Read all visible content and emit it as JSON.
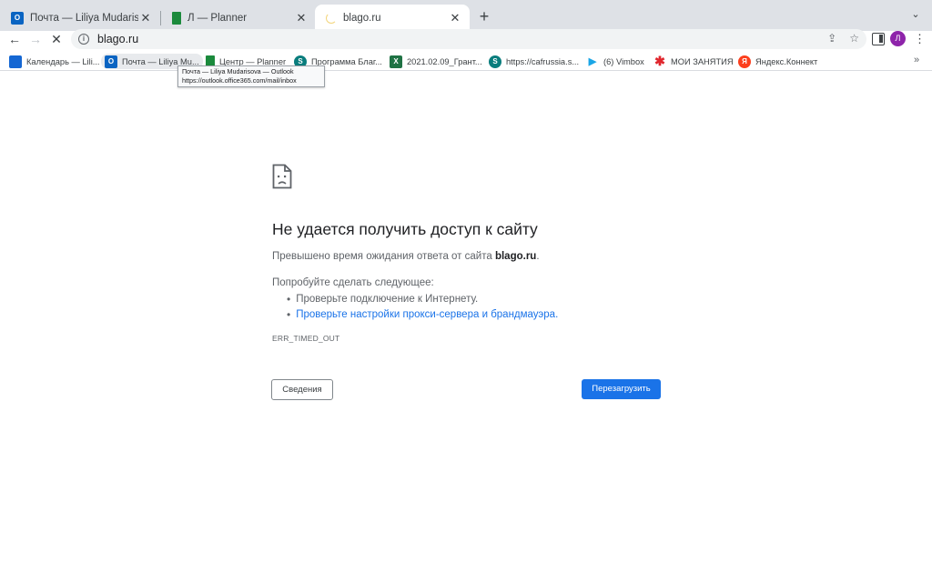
{
  "tabs": [
    {
      "title": "Почта — Liliya Mudarisova — ",
      "favicon": "outlook-icon"
    },
    {
      "title": "Л — Planner",
      "favicon": "planner-icon"
    },
    {
      "title": "blago.ru",
      "favicon": "loading-spinner-icon",
      "active": true
    }
  ],
  "toolbar": {
    "url": "blago.ru",
    "avatar_letter": "Л"
  },
  "bookmarks": [
    {
      "label": "Календарь — Lili...",
      "icon": "calendar-icon"
    },
    {
      "label": "Почта — Liliya Mu...",
      "icon": "outlook-icon"
    },
    {
      "label": "Центр — Planner",
      "icon": "planner-icon"
    },
    {
      "label": "Программа Благ...",
      "icon": "sway-icon"
    },
    {
      "label": "2021.02.09_Грант...",
      "icon": "excel-icon"
    },
    {
      "label": "https://cafrussia.s...",
      "icon": "sway-icon"
    },
    {
      "label": "(6) Vimbox",
      "icon": "vimbox-icon"
    },
    {
      "label": "МОИ ЗАНЯТИЯ",
      "icon": "star-icon"
    },
    {
      "label": "Яндекс.Коннект",
      "icon": "yandex-icon"
    }
  ],
  "tooltip": {
    "title": "Почта — Liliya Mudarisova — Outlook",
    "url": "https://outlook.office365.com/mail/inbox"
  },
  "error": {
    "title": "Не удается получить доступ к сайту",
    "summary_prefix": "Превышено время ожидания ответа от сайта ",
    "summary_host": "blago.ru",
    "summary_suffix": ".",
    "try_heading": "Попробуйте сделать следующее:",
    "suggestion_1": "Проверьте подключение к Интернету.",
    "suggestion_2_link": "Проверьте настройки прокси-сервера и брандмауэра.",
    "code": "ERR_TIMED_OUT",
    "details_button": "Сведения",
    "reload_button": "Перезагрузить"
  },
  "colors": {
    "accent": "#1a73e8",
    "avatar_bg": "#8e24aa",
    "tabstrip_bg": "#dee1e6"
  }
}
